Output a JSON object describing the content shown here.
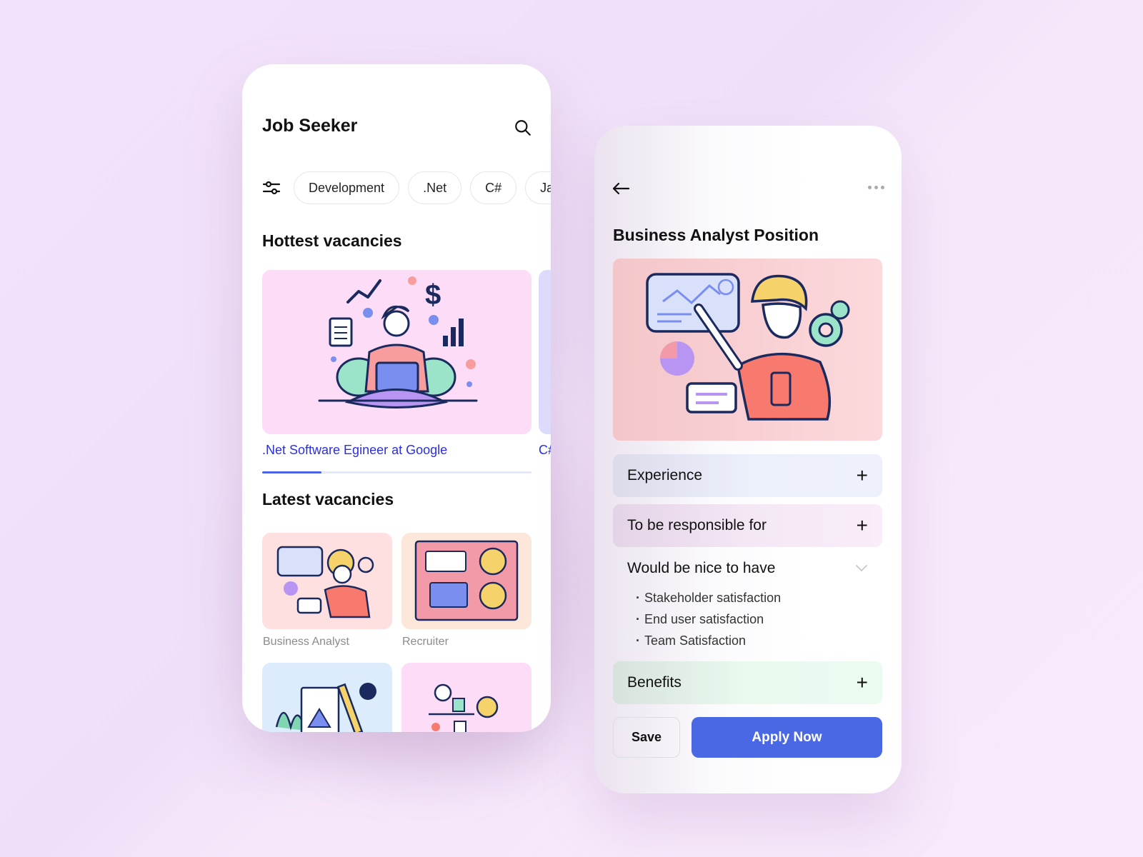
{
  "left_screen": {
    "title": "Job Seeker",
    "search_icon": "search-icon",
    "filter_icon": "sliders-icon",
    "chips": [
      {
        "label": "Development"
      },
      {
        "label": ".Net"
      },
      {
        "label": "C#"
      },
      {
        "label": "Ja"
      }
    ],
    "hottest": {
      "heading": "Hottest vacancies",
      "cards": [
        {
          "label": ".Net Software Egineer at Google",
          "bg": "#fcdcf6"
        },
        {
          "label": "C#",
          "bg": "#dcdcfc"
        }
      ],
      "carousel_progress": 0.22
    },
    "latest": {
      "heading": "Latest vacancies",
      "tiles": [
        {
          "label": "Business Analyst",
          "bg": "#fde0df"
        },
        {
          "label": "Recruiter",
          "bg": "#fde7da"
        },
        {
          "label": "",
          "bg": "#dcecfc"
        },
        {
          "label": "",
          "bg": "#fcdcf6"
        }
      ]
    }
  },
  "right_screen": {
    "back_icon": "arrow-left-icon",
    "more_icon": "more-horizontal-icon",
    "title": "Business Analyst Position",
    "accordions": [
      {
        "label": "Experience",
        "expanded": false
      },
      {
        "label": "To be responsible for",
        "expanded": false
      },
      {
        "label": "Would be nice to have",
        "expanded": true,
        "items": [
          "Stakeholder satisfaction",
          "End user satisfaction",
          "Team Satisfaction"
        ]
      },
      {
        "label": "Benefits",
        "expanded": false
      }
    ],
    "save_label": "Save",
    "apply_label": "Apply Now"
  },
  "colors": {
    "accent": "#4a68e3",
    "link": "#2b2fe0",
    "background": "#f3e3fa"
  }
}
